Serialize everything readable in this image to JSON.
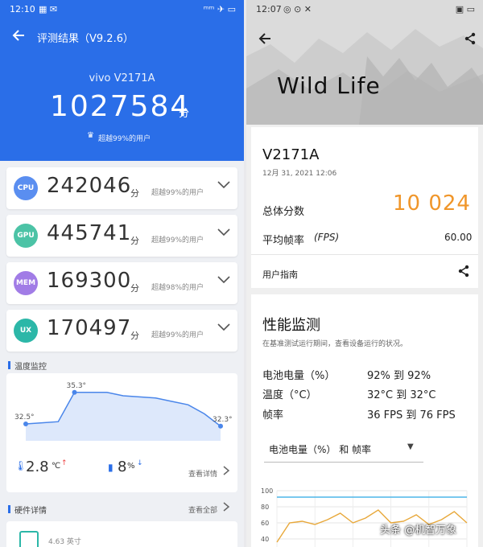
{
  "left": {
    "status": {
      "time": "12:10",
      "icons": "▦ ✉",
      "right": "ᵐᵐ ✈ ▭"
    },
    "header": {
      "title": "评测结果（V9.2.6）",
      "device": "vivo  V2171A",
      "score": "1027584",
      "score_unit": "分",
      "rank_text": "超越99%的用户"
    },
    "categories": [
      {
        "label": "CPU",
        "value": "242046",
        "unit": "分",
        "rank": "超越99%的用户",
        "color": "#5a8ef0"
      },
      {
        "label": "GPU",
        "value": "445741",
        "unit": "分",
        "rank": "超越99%的用户",
        "color": "#4cc3a6"
      },
      {
        "label": "MEM",
        "value": "169300",
        "unit": "分",
        "rank": "超越98%的用户",
        "color": "#a17ce6"
      },
      {
        "label": "UX",
        "value": "170497",
        "unit": "分",
        "rank": "超越99%的用户",
        "color": "#2cb7a8"
      }
    ],
    "temp_section": {
      "title": "温度监控"
    },
    "temp_chart": {
      "chart_data": {
        "type": "area",
        "labels": [
          "32.5°",
          "35.3°",
          "32.3°"
        ],
        "x": [
          0,
          1,
          2,
          3,
          4,
          5,
          6,
          7,
          8,
          9,
          10,
          11,
          12
        ],
        "values": [
          32.5,
          32.6,
          32.7,
          35.3,
          35.3,
          35.3,
          35.0,
          34.9,
          34.8,
          34.5,
          34.2,
          33.4,
          32.3
        ]
      },
      "temp_delta": "2.8",
      "temp_unit": "℃",
      "temp_arrow": "↑",
      "battery_delta": "8",
      "battery_unit": "%",
      "battery_arrow": "↓",
      "detail_link": "查看详情"
    },
    "hardware": {
      "title": "硬件详情",
      "view_all": "查看全部",
      "partial": "4.63  英寸"
    }
  },
  "right": {
    "status": {
      "time": "12:07",
      "icons": "◎ ⊙ ✕",
      "right": "▣ ▭"
    },
    "banner_title": "Wild Life",
    "device": "V2171A",
    "date": "12月 31, 2021 12:06",
    "score_label": "总体分数",
    "score": "10 024",
    "fps_label": "平均帧率",
    "fps_unit": "(FPS)",
    "fps_value": "60.00",
    "guide_label": "用户指南",
    "perf": {
      "title": "性能监测",
      "desc": "在基准测试运行期间，查看设备运行的状况。",
      "rows": [
        {
          "label": "电池电量（%）",
          "value": "92% 到 92%"
        },
        {
          "label": "温度（°C）",
          "value": "32°C 到 32°C"
        },
        {
          "label": "帧率",
          "value": "36 FPS 到 76 FPS"
        }
      ],
      "dropdown": "电池电量（%） 和 帧率"
    },
    "mini_chart": {
      "chart_data": {
        "type": "line",
        "ylim": [
          20,
          100
        ],
        "yticks": [
          "100",
          "80",
          "60",
          "40"
        ],
        "series": [
          {
            "values": [
              92,
              92,
              92,
              92,
              92,
              92,
              92,
              92,
              92,
              92
            ]
          },
          {
            "values": [
              36,
              60,
              62,
              58,
              64,
              72,
              60,
              66,
              76,
              60,
              62,
              70,
              58,
              64,
              74,
              60
            ]
          }
        ]
      }
    },
    "watermark": "头条 @机智万象"
  }
}
